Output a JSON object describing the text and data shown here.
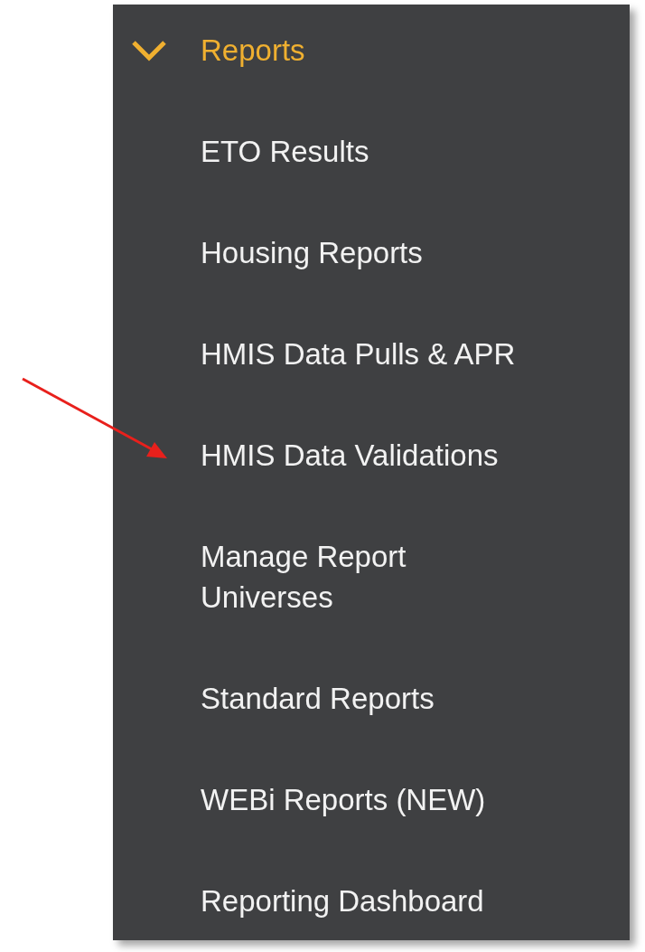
{
  "menu": {
    "header": {
      "label": "Reports",
      "expanded": true
    },
    "items": [
      {
        "label": "ETO Results"
      },
      {
        "label": "Housing Reports"
      },
      {
        "label": "HMIS Data Pulls & APR"
      },
      {
        "label": "HMIS Data Validations"
      },
      {
        "label": "Manage Report Universes"
      },
      {
        "label": "Standard Reports"
      },
      {
        "label": "WEBi Reports (NEW)"
      },
      {
        "label": "Reporting Dashboard"
      }
    ]
  }
}
